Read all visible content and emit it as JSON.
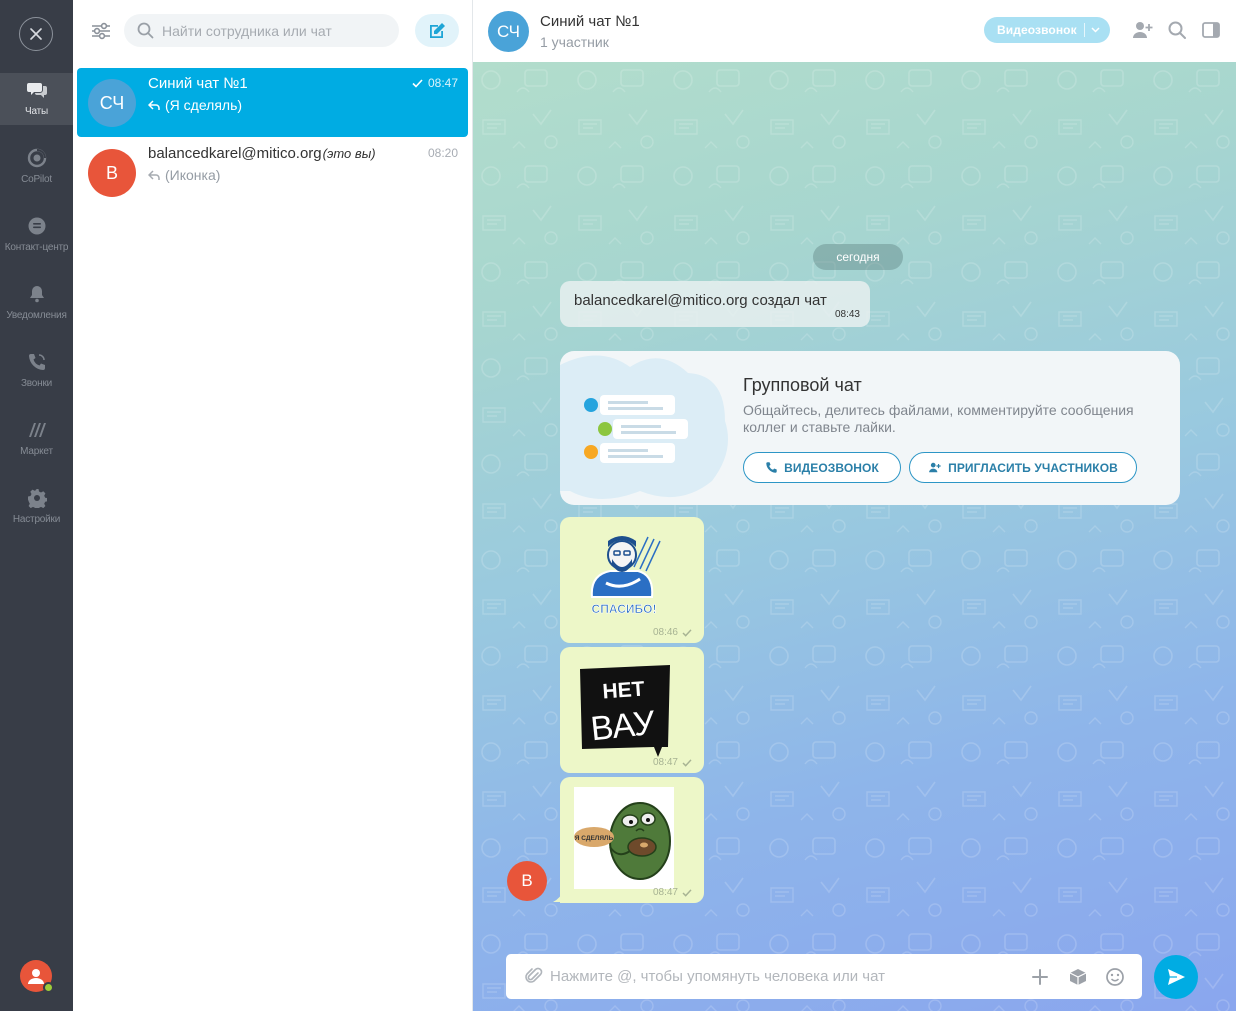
{
  "rail": {
    "items": [
      {
        "label": "Чаты",
        "icon": "chats-icon"
      },
      {
        "label": "CoPilot",
        "icon": "copilot-icon"
      },
      {
        "label": "Контакт-центр",
        "icon": "contact-center-icon"
      },
      {
        "label": "Уведомления",
        "icon": "bell-icon"
      },
      {
        "label": "Звонки",
        "icon": "phone-icon"
      },
      {
        "label": "Маркет",
        "icon": "market-icon"
      },
      {
        "label": "Настройки",
        "icon": "gear-icon"
      }
    ]
  },
  "list": {
    "search_placeholder": "Найти сотрудника или чат",
    "chats": [
      {
        "avatar": "СЧ",
        "title": "Синий чат №1",
        "time": "08:47",
        "last_message": "(Я сделяль)",
        "active": true
      },
      {
        "avatar": "B",
        "title": "balancedkarel@mitico.org",
        "me_label": "(это вы)",
        "time": "08:20",
        "last_message": "(Иконка)",
        "active": false
      }
    ]
  },
  "header": {
    "avatar": "СЧ",
    "title": "Синий чат №1",
    "subtitle": "1 участник",
    "video_button": "Видеозвонок"
  },
  "messages": {
    "date_pill": "сегодня",
    "system": {
      "text": "balancedkarel@mitico.org создал чат",
      "time": "08:43"
    },
    "promo": {
      "title": "Групповой чат",
      "text": "Общайтесь, делитесь файлами, комментируйте сообщения коллег и ставьте лайки.",
      "btn_video": "ВИДЕОЗВОНОК",
      "btn_invite": "ПРИГЛАСИТЬ УЧАСТНИКОВ"
    },
    "stickers": [
      {
        "name": "sticker-spasibo",
        "caption": "СПАСИБО!",
        "time": "08:46"
      },
      {
        "name": "sticker-net-vau",
        "caption": "НЕТ ВАУ",
        "time": "08:47"
      },
      {
        "name": "sticker-ya-sdelyal",
        "caption": "Я СДЕЛЯЛЬ",
        "time": "08:47"
      }
    ],
    "author_avatar": "B"
  },
  "composer": {
    "placeholder": "Нажмите @, чтобы упомянуть человека или чат"
  },
  "colors": {
    "rail_bg": "#383d47",
    "accent": "#00ace3",
    "avatar_group": "#4aa3d8",
    "avatar_user": "#e8553a",
    "sticker_bubble": "#edf7c8"
  }
}
